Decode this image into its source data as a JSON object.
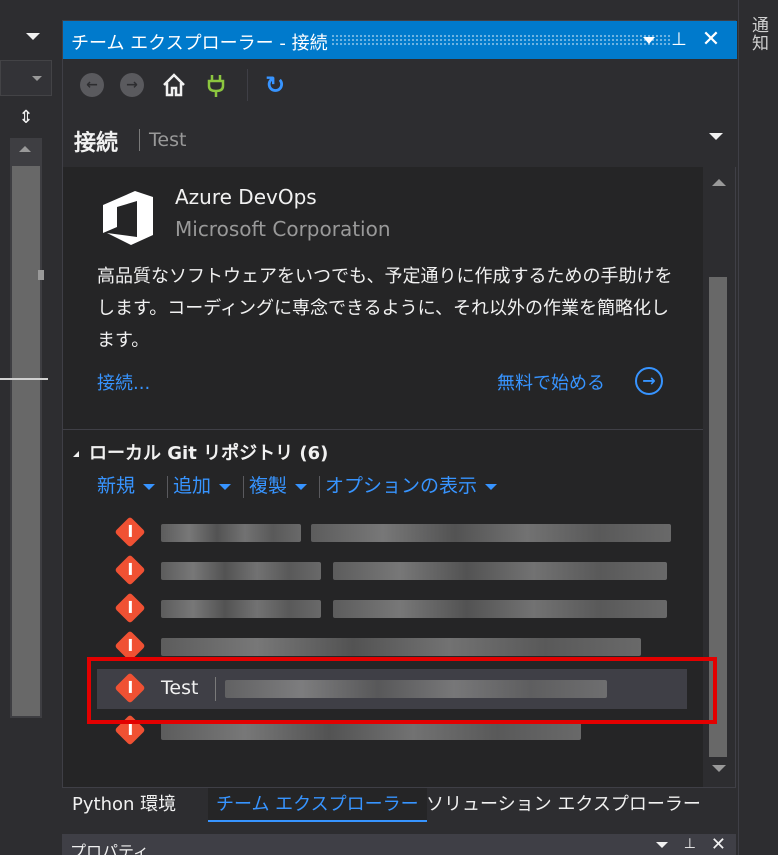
{
  "panel": {
    "title": "チーム エクスプローラー - 接続",
    "header_title": "接続",
    "header_sub": "Test"
  },
  "toolbar": {
    "icons": [
      "back-icon",
      "forward-icon",
      "home-icon",
      "plug-icon",
      "refresh-icon"
    ]
  },
  "service": {
    "name": "Azure DevOps",
    "vendor": "Microsoft Corporation",
    "description": "高品質なソフトウェアをいつでも、予定通りに作成するための手助けをします。コーディングに専念できるように、それ以外の作業を簡略化します。",
    "connect_link": "接続...",
    "start_link": "無料で始める"
  },
  "local_git": {
    "heading": "ローカル Git リポジトリ (6)",
    "actions": [
      "新規",
      "追加",
      "複製",
      "オプションの表示"
    ],
    "repos": [
      {
        "name": "",
        "selected": false
      },
      {
        "name": "",
        "selected": false
      },
      {
        "name": "",
        "selected": false
      },
      {
        "name": "",
        "selected": false
      },
      {
        "name": "Test",
        "selected": true
      },
      {
        "name": "",
        "selected": false
      }
    ]
  },
  "tabs": [
    "Python 環境",
    "チーム エクスプローラー",
    "ソリューション エクスプローラー"
  ],
  "active_tab": "チーム エクスプローラー",
  "side_label": "通知",
  "bottom_panel_title": "プロパティ",
  "colors": {
    "accent": "#007acc",
    "link": "#3794ff",
    "highlight": "#e30000",
    "git": "#f05133"
  }
}
